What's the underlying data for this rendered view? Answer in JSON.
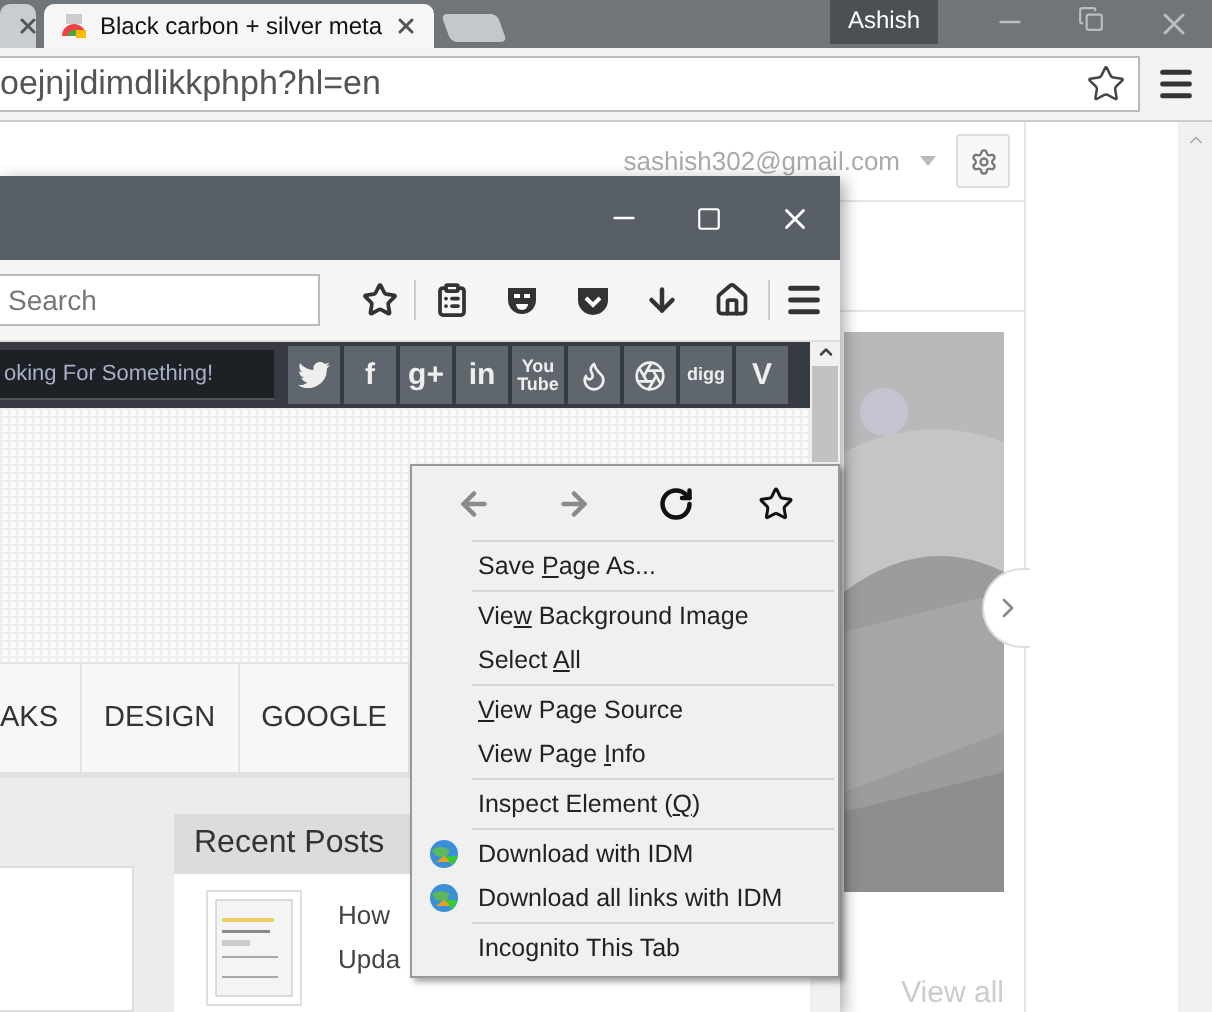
{
  "browser": {
    "tabs": [
      {
        "selected": false
      },
      {
        "title": "Black carbon + silver meta",
        "selected": true
      }
    ],
    "profile": "Ashish",
    "address": "oejnjldimdlikkphph?hl=en",
    "account": "sashish302@gmail.com",
    "view_all": "View all"
  },
  "firefox": {
    "search": {
      "placeholder": "Search"
    },
    "site_search": {
      "placeholder": "oking For Something!"
    },
    "social": [
      {
        "kind": "bird"
      },
      {
        "kind": "text",
        "label": "f"
      },
      {
        "kind": "text",
        "label": "g+"
      },
      {
        "kind": "text",
        "label": "in"
      },
      {
        "kind": "text",
        "label": "You Tube"
      },
      {
        "kind": "flame"
      },
      {
        "kind": "aperture"
      },
      {
        "kind": "text",
        "label": "digg"
      },
      {
        "kind": "text",
        "label": "V"
      }
    ],
    "nav": [
      "AKS",
      "DESIGN",
      "GOOGLE"
    ],
    "recent_posts": {
      "title": "Recent Posts",
      "lines": [
        "How",
        "Upda"
      ]
    }
  },
  "context_menu": {
    "nav": [
      {
        "kind": "back",
        "disabled": true
      },
      {
        "kind": "forward",
        "disabled": true
      },
      {
        "kind": "reload",
        "disabled": false
      },
      {
        "kind": "bookmark",
        "disabled": false
      }
    ],
    "groups": [
      [
        {
          "kind": "plain",
          "before": "Save ",
          "key": "P",
          "after": "age As..."
        }
      ],
      [
        {
          "kind": "plain",
          "before": "Vie",
          "key": "w",
          "after": " Background Image"
        },
        {
          "kind": "plain",
          "before": "Select ",
          "key": "A",
          "after": "ll"
        }
      ],
      [
        {
          "kind": "plain",
          "key": "V",
          "after": "iew Page Source"
        },
        {
          "kind": "plain",
          "before": "View Page ",
          "key": "I",
          "after": "nfo"
        }
      ],
      [
        {
          "kind": "plain",
          "before": "Inspect Element (",
          "key": "Q",
          "after": ")"
        }
      ],
      [
        {
          "kind": "idm",
          "before": "Download with IDM"
        },
        {
          "kind": "idm",
          "before": "Download all links with IDM"
        }
      ],
      [
        {
          "kind": "plain",
          "before": "Incognito This Tab"
        }
      ]
    ]
  }
}
